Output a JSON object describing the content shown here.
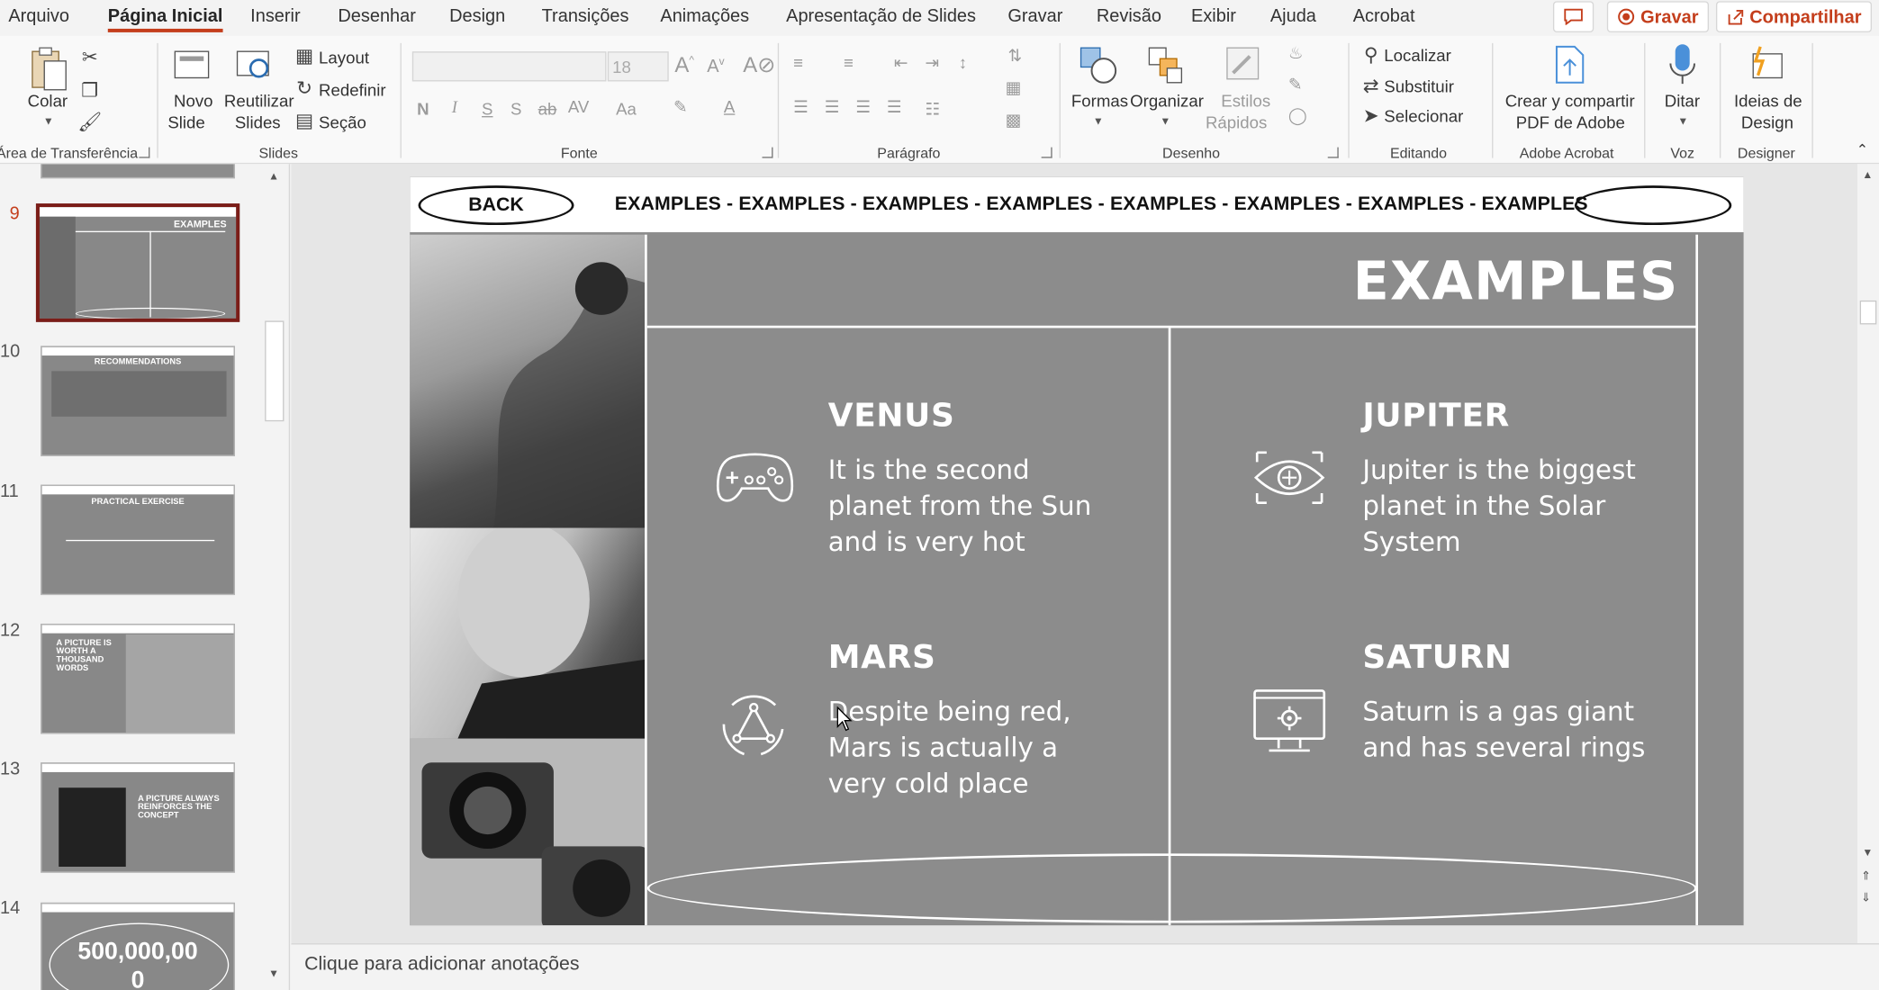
{
  "menu": {
    "tabs": [
      "Arquivo",
      "Página Inicial",
      "Inserir",
      "Desenhar",
      "Design",
      "Transições",
      "Animações",
      "Apresentação de Slides",
      "Gravar",
      "Revisão",
      "Exibir",
      "Ajuda",
      "Acrobat"
    ],
    "record_label": "Gravar",
    "share_label": "Compartilhar"
  },
  "ribbon": {
    "clipboard": {
      "paste": "Colar",
      "group": "Área de Transferência"
    },
    "slides": {
      "new_slide_1": "Novo",
      "new_slide_2": "Slide",
      "reuse_1": "Reutilizar",
      "reuse_2": "Slides",
      "layout": "Layout",
      "reset": "Redefinir",
      "section": "Seção",
      "group": "Slides"
    },
    "font": {
      "name": "",
      "size": "18",
      "group": "Fonte"
    },
    "paragraph": {
      "group": "Parágrafo"
    },
    "drawing": {
      "shapes": "Formas",
      "arrange": "Organizar",
      "quick_styles_1": "Estilos",
      "quick_styles_2": "Rápidos",
      "group": "Desenho"
    },
    "editing": {
      "find": "Localizar",
      "replace": "Substituir",
      "select": "Selecionar",
      "group": "Editando"
    },
    "acrobat": {
      "create_1": "Crear y compartir",
      "create_2": "PDF de Adobe",
      "group": "Adobe Acrobat"
    },
    "voice": {
      "dictate": "Ditar",
      "group": "Voz"
    },
    "designer": {
      "ideas_1": "Ideias de",
      "ideas_2": "Design",
      "group": "Designer"
    }
  },
  "thumbnails": {
    "numbers": [
      "9",
      "10",
      "11",
      "12",
      "13",
      "14"
    ],
    "t9_title": "EXAMPLES",
    "t10_title": "RECOMMENDATIONS",
    "t11_title": "PRACTICAL EXERCISE",
    "t12_title": "A PICTURE IS WORTH A THOUSAND WORDS",
    "t13_title": "A PICTURE ALWAYS REINFORCES THE CONCEPT",
    "t14_title": "500,000,00",
    "t14_extra": "0"
  },
  "slide": {
    "back": "BACK",
    "marquee": "EXAMPLES - EXAMPLES - EXAMPLES - EXAMPLES - EXAMPLES - EXAMPLES - EXAMPLES - EXAMPLES",
    "title": "EXAMPLES",
    "items": [
      {
        "title": "VENUS",
        "text": "It is the second planet from the Sun and is very hot",
        "icon": "gamepad-icon"
      },
      {
        "title": "JUPITER",
        "text": "Jupiter is the biggest planet in the Solar System",
        "icon": "eye-target-icon"
      },
      {
        "title": "MARS",
        "text": "Despite being red, Mars is actually a very cold place",
        "icon": "triangle-cycle-icon"
      },
      {
        "title": "SATURN",
        "text": "Saturn is a gas giant and has several rings",
        "icon": "monitor-gear-icon"
      }
    ]
  },
  "notes_placeholder": "Clique para adicionar anotações",
  "colors": {
    "accent": "#c43e1c",
    "slide_bg": "#8c8c8c",
    "selected_thumb_border": "#7b1d18"
  }
}
